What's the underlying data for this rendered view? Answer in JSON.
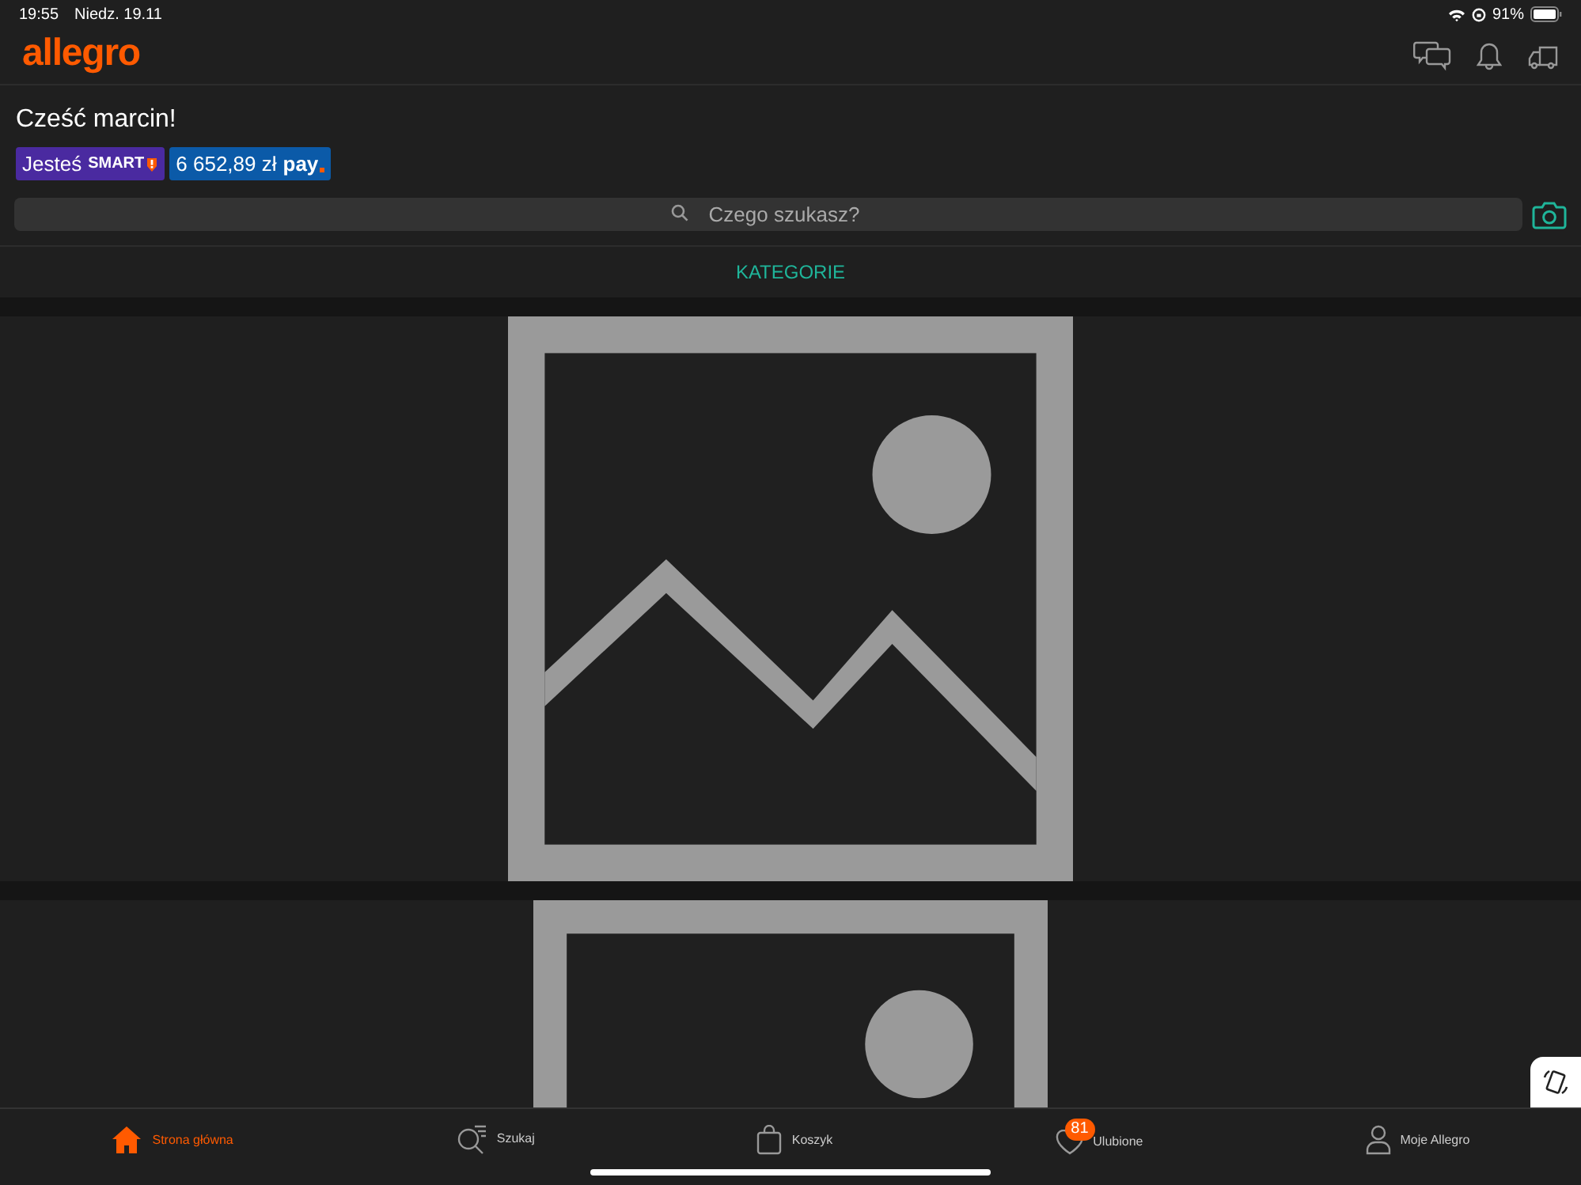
{
  "status_bar": {
    "time": "19:55",
    "date": "Niedz. 19.11",
    "battery": "91%"
  },
  "header": {
    "logo": "allegro"
  },
  "greeting": "Cześć marcin!",
  "badges": [
    {
      "kind": "smart",
      "label": "Jesteś",
      "tag": "SMART"
    },
    {
      "kind": "pay",
      "label": "6 652,89 zł",
      "tag": "pay"
    }
  ],
  "search": {
    "placeholder": "Czego szukasz?"
  },
  "categories_link": "KATEGORIE",
  "tab_bar": [
    {
      "label": "Strona główna",
      "kind": "home",
      "selected": true
    },
    {
      "label": "Szukaj",
      "kind": "search",
      "selected": false
    },
    {
      "label": "Koszyk",
      "kind": "bag",
      "selected": false
    },
    {
      "label": "Ulubione",
      "kind": "heart",
      "selected": false,
      "badge": "81"
    },
    {
      "label": "Moje Allegro",
      "kind": "user",
      "selected": false
    }
  ]
}
